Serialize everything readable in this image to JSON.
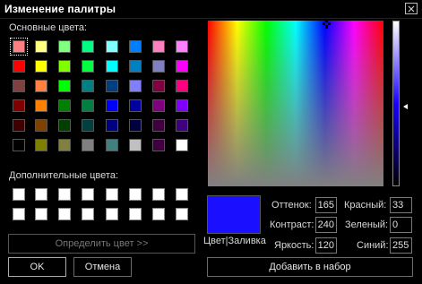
{
  "window": {
    "title": "Изменение палитры"
  },
  "basic_colors": {
    "label": "Основные цвета:",
    "swatches": [
      "#ff8080",
      "#ffff80",
      "#80ff80",
      "#00ff80",
      "#80ffff",
      "#0080ff",
      "#ff80c0",
      "#ff80ff",
      "#ff0000",
      "#ffff00",
      "#80ff00",
      "#00ff40",
      "#00ffff",
      "#0080c0",
      "#8080c0",
      "#ff00ff",
      "#804040",
      "#ff8040",
      "#00ff00",
      "#008080",
      "#004080",
      "#8080ff",
      "#800040",
      "#ff0080",
      "#800000",
      "#ff8000",
      "#008000",
      "#008040",
      "#0000ff",
      "#0000a0",
      "#800080",
      "#8000ff",
      "#400000",
      "#804000",
      "#004000",
      "#004040",
      "#000080",
      "#000040",
      "#400040",
      "#400080",
      "#000000",
      "#808000",
      "#808040",
      "#808080",
      "#408080",
      "#c0c0c0",
      "#400040",
      "#ffffff"
    ]
  },
  "custom_colors": {
    "label": "Дополнительные цвета:"
  },
  "buttons": {
    "define": "Определить цвет >>",
    "ok": "OK",
    "cancel": "Отмена",
    "add": "Добавить в набор"
  },
  "preview": {
    "label": "Цвет|Заливка",
    "color": "#1a10ff"
  },
  "fields": {
    "hue": {
      "label": "Оттенок:",
      "value": "165"
    },
    "sat": {
      "label": "Контраст:",
      "value": "240"
    },
    "lum": {
      "label": "Яркость:",
      "value": "120"
    },
    "red": {
      "label": "Красный:",
      "value": "33"
    },
    "green": {
      "label": "Зеленый:",
      "value": "0"
    },
    "blue": {
      "label": "Синий:",
      "value": "255"
    }
  }
}
